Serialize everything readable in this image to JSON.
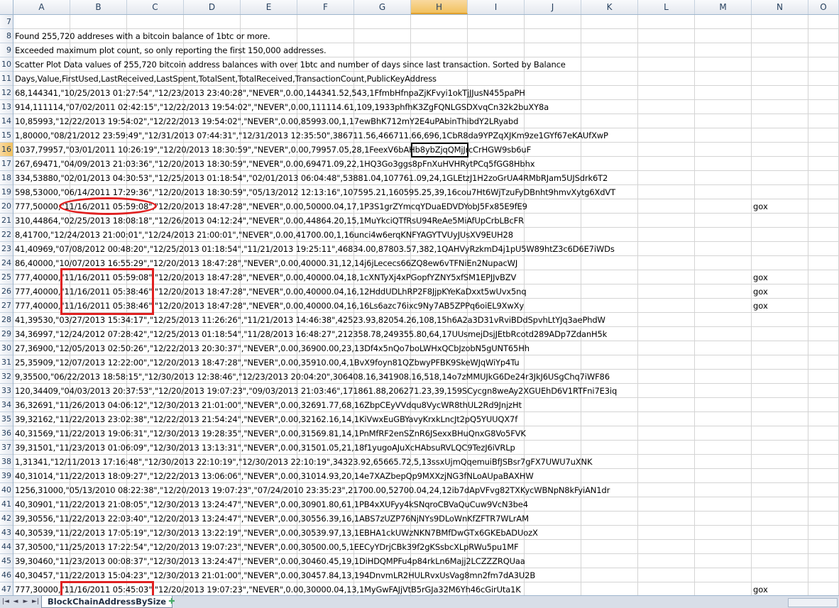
{
  "columns": [
    "A",
    "B",
    "C",
    "D",
    "E",
    "F",
    "G",
    "H",
    "I",
    "J",
    "K",
    "L",
    "M",
    "N",
    "O"
  ],
  "active_column": "H",
  "active_row": "16",
  "rows": [
    {
      "n": "7",
      "text": ""
    },
    {
      "n": "8",
      "text": "Found 255,720 addreses with a bitcoin balance of 1btc or more."
    },
    {
      "n": "9",
      "text": "Exceeded maximum plot count, so only reporting the first 150,000 addresses."
    },
    {
      "n": "10",
      "text": "Scatter Plot Data values of 255,720 bitcoin address balances with over 1btc and number of days since last transaction. Sorted by Balance"
    },
    {
      "n": "11",
      "text": "Days,Value,FirstUsed,LastReceived,LastSpent,TotalSent,TotalReceived,TransactionCount,PublicKeyAddress"
    },
    {
      "n": "12",
      "text": "68,144341,\"10/25/2013 01:27:54\",\"12/23/2013 23:40:28\",\"NEVER\",0.00,144341.52,543,1FfmbHfnpaZjKFvyi1okTjJJusN455paPH"
    },
    {
      "n": "13",
      "text": "914,111114,\"07/02/2011 02:42:15\",\"12/22/2013 19:54:02\",\"NEVER\",0.00,111114.61,109,1933phfhK3ZgFQNLGSDXvqCn32k2buXY8a"
    },
    {
      "n": "14",
      "text": "10,85993,\"12/22/2013 19:54:02\",\"12/22/2013 19:54:02\",\"NEVER\",0.00,85993.00,1,17ewBhK712mY2E4uPAbinThibdY2LRyabd"
    },
    {
      "n": "15",
      "text": "1,80000,\"08/21/2012 23:59:49\",\"12/31/2013 07:44:31\",\"12/31/2013 12:35:50\",386711.56,466711.66,696,1CbR8da9YPZqXJKm9ze1GYf67eKAUfXwP"
    },
    {
      "n": "16",
      "text": "1037,79957,\"03/01/2011 10:26:19\",\"12/20/2013 18:30:59\",\"NEVER\",0.00,79957.05,28,1FeexV6bAHb8ybZjqQMjJrcCrHGW9sb6uF"
    },
    {
      "n": "17",
      "text": "267,69471,\"04/09/2013 21:03:36\",\"12/20/2013 18:30:59\",\"NEVER\",0.00,69471.09,22,1HQ3Go3ggs8pFnXuHVHRytPCq5fGG8Hbhx"
    },
    {
      "n": "18",
      "text": "334,53880,\"02/01/2013 04:30:53\",\"12/25/2013 01:18:54\",\"02/01/2013 06:04:48\",53881.04,107761.09,24,1GLEtzJ1H2zoGrUA4RMbRJam5UJSdrk6T2"
    },
    {
      "n": "19",
      "text": "598,53000,\"06/14/2011 17:29:36\",\"12/20/2013 18:30:59\",\"05/13/2012 12:13:16\",107595.21,160595.25,39,16cou7Ht6WjTzuFyDBnht9hmvXytg6XdVT"
    },
    {
      "n": "20",
      "text": "777,50000,\"11/16/2011 05:59:08\",\"12/20/2013 18:47:28\",\"NEVER\",0.00,50000.04,17,1P3S1grZYmcqYDuaEDVDYobJ5Fx85E9fE9",
      "note": "gox"
    },
    {
      "n": "21",
      "text": "310,44864,\"02/25/2013 18:08:18\",\"12/26/2013 04:12:24\",\"NEVER\",0.00,44864.20,15,1MuYkciQTfRsU94ReAe5MiAfUpCrbLBcFR"
    },
    {
      "n": "22",
      "text": "8,41700,\"12/24/2013 21:00:01\",\"12/24/2013 21:00:01\",\"NEVER\",0.00,41700.00,1,16unci4w6erqKNFYAGYTVUyJUsXV9EUH28"
    },
    {
      "n": "23",
      "text": "41,40969,\"07/08/2012 00:48:20\",\"12/25/2013 01:18:54\",\"11/21/2013 19:25:11\",46834.00,87803.57,382,1QAHVyRzkmD4j1pU5W89htZ3c6D6E7iWDs"
    },
    {
      "n": "24",
      "text": "86,40000,\"10/07/2013 16:55:29\",\"12/20/2013 18:47:28\",\"NEVER\",0.00,40000.31,12,14j6jLececs66ZQ8ew6vTFNiEn2NupacWJ"
    },
    {
      "n": "25",
      "text": "777,40000,\"11/16/2011 05:59:08\",\"12/20/2013 18:47:28\",\"NEVER\",0.00,40000.04,18,1cXNTyXj4xPGopfYZNY5xfSM1EPJJvBZV",
      "note": "gox"
    },
    {
      "n": "26",
      "text": "777,40000,\"11/16/2011 05:38:46\",\"12/20/2013 18:47:28\",\"NEVER\",0.00,40000.04,16,12HddUDLhRP2F8JjpKYeKaDxxt5wUvx5nq",
      "note": "gox"
    },
    {
      "n": "27",
      "text": "777,40000,\"11/16/2011 05:38:46\",\"12/20/2013 18:47:28\",\"NEVER\",0.00,40000.04,16,16Ls6azc76ixc9Ny7AB5ZPPq6oiEL9XwXy",
      "note": "gox"
    },
    {
      "n": "28",
      "text": "41,39530,\"03/27/2013 15:34:17\",\"12/25/2013 11:26:26\",\"11/21/2013 14:46:38\",42523.93,82054.26,108,15h6A2a3D31vRviBDdSpvhLtYJq3aePhdW"
    },
    {
      "n": "29",
      "text": "34,36997,\"12/24/2012 07:28:42\",\"12/25/2013 01:18:54\",\"11/28/2013 16:48:27\",212358.78,249355.80,64,17UUsmejDsjJEtbRcotd289ADp7ZdanH5k"
    },
    {
      "n": "30",
      "text": "27,36900,\"12/05/2013 02:50:26\",\"12/22/2013 20:30:37\",\"NEVER\",0.00,36900.00,23,13Df4x5nQo7boLWHxQCbJzobN5gUNT65Hh"
    },
    {
      "n": "31",
      "text": "25,35909,\"12/07/2013 12:22:00\",\"12/20/2013 18:47:28\",\"NEVER\",0.00,35910.00,4,1BvX9foyn81QZbwyPFBK9SkeWJqWiYp4Tu"
    },
    {
      "n": "32",
      "text": "9,35500,\"06/22/2013 18:58:15\",\"12/30/2013 12:38:46\",\"12/23/2013 20:04:20\",306408.16,341908.16,518,14o7zMMUJkG6De24r3JkJ6USgChq7iWF86"
    },
    {
      "n": "33",
      "text": "120,34409,\"04/03/2013 20:37:53\",\"12/20/2013 19:07:23\",\"09/03/2013 21:03:46\",171861.88,206271.23,39,159SCycgn8weAy2XGUEhD6V1RTFni7E3iq"
    },
    {
      "n": "34",
      "text": "36,32691,\"11/26/2013 04:06:12\",\"12/30/2013 21:01:00\",\"NEVER\",0.00,32691.77,68,16ZbpCEyVVdqu8VycWR8thUL2Rd9JnjzHt"
    },
    {
      "n": "35",
      "text": "39,32162,\"11/22/2013 23:02:38\",\"12/22/2013 21:54:24\",\"NEVER\",0.00,32162.16,14,1KiVwxEuGBYavyKrxkLncJt2pQ5YUUQX7f"
    },
    {
      "n": "36",
      "text": "40,31569,\"11/22/2013 19:06:31\",\"12/30/2013 19:28:35\",\"NEVER\",0.00,31569.81,14,1PnMfRF2enSZnR6JSexxBHuQnxG8Vo5FVK"
    },
    {
      "n": "37",
      "text": "39,31501,\"11/23/2013 01:06:09\",\"12/30/2013 13:13:31\",\"NEVER\",0.00,31501.05,21,18f1yugoAJuXcHAbsuRVLQC9TezJ6iVRLp"
    },
    {
      "n": "38",
      "text": "1,31341,\"12/11/2013 17:16:48\",\"12/30/2013 22:10:19\",\"12/30/2013 22:10:19\",34323.92,65665.72,5,13ssxUjmQqemuiBfJSBsr7gFX7UWU7uXNK"
    },
    {
      "n": "39",
      "text": "40,31014,\"11/22/2013 18:09:27\",\"12/22/2013 13:06:06\",\"NEVER\",0.00,31014.93,20,14e7XAZbepQp9MXXzjNG3fNLoAUpaBAXHW"
    },
    {
      "n": "40",
      "text": "1256,31000,\"05/13/2010 08:22:38\",\"12/20/2013 19:07:23\",\"07/24/2010 23:35:23\",21700.00,52700.04,24,12ib7dApVFvg82TXKycWBNpN8kFyiAN1dr"
    },
    {
      "n": "41",
      "text": "40,30901,\"11/22/2013 21:08:05\",\"12/30/2013 13:24:47\",\"NEVER\",0.00,30901.80,61,1PB4xXUFyy4kSNqroCBVaQuCuw9VcN3be4"
    },
    {
      "n": "42",
      "text": "39,30556,\"11/22/2013 22:03:40\",\"12/20/2013 13:24:47\",\"NEVER\",0.00,30556.39,16,1ABS7zUZP76NjNYs9DLoWnKfZFTR7WLrAM"
    },
    {
      "n": "43",
      "text": "40,30539,\"11/22/2013 17:05:19\",\"12/30/2013 13:22:19\",\"NEVER\",0.00,30539.97,13,1EBHA1ckUWzNKN7BMfDwGTx6GKEbADUozX"
    },
    {
      "n": "44",
      "text": "37,30500,\"11/25/2013 17:22:54\",\"12/20/2013 19:07:23\",\"NEVER\",0.00,30500.00,5,1EECyYDrjCBk39f2gKSsbcXLpRWu5pu1MF"
    },
    {
      "n": "45",
      "text": "39,30460,\"11/23/2013 00:08:37\",\"12/30/2013 13:24:47\",\"NEVER\",0.00,30460.45,19,1DiHDQMPFu4p84rkLn6Majj2LCZZZRQUaa"
    },
    {
      "n": "46",
      "text": "40,30457,\"11/22/2013 15:04:23\",\"12/30/2013 21:01:00\",\"NEVER\",0.00,30457.84,13,194DnvmLR2HULRvxUsVag8mn2fm7dA3U2B"
    },
    {
      "n": "47",
      "text": "777,30000,\"11/16/2011 05:45:03\",\"12/20/2013 19:07:23\",\"NEVER\",0.00,30000.04,13,1MyGwFAJjVtB5rGJa32M6Yh46cGirUta1K",
      "note": "gox"
    }
  ],
  "sheet_tab": "BlockChainAddressBySize",
  "nav": {
    "first": "|◄",
    "prev": "◄",
    "next": "►",
    "last": "►|"
  },
  "new_sheet_icon": "sheet-insert-icon",
  "highlight_color": "#e02020"
}
